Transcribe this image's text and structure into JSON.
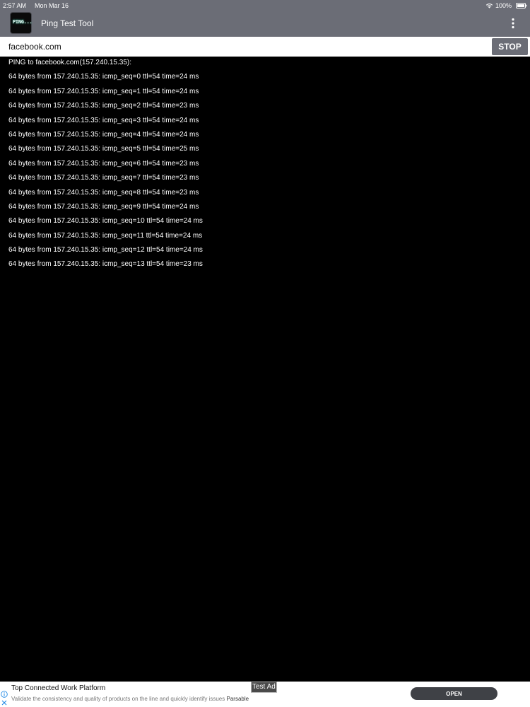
{
  "status_bar": {
    "time": "2:57 AM",
    "date": "Mon Mar 16",
    "battery": "100%",
    "icons": [
      "wifi-icon",
      "battery-icon"
    ]
  },
  "nav": {
    "app_icon_text": "PING...",
    "title": "Ping Test Tool",
    "menu_icon": "more-vertical-icon"
  },
  "address_bar": {
    "host_value": "facebook.com",
    "stop_label": "STOP"
  },
  "output": {
    "header": "PING to facebook.com(157.240.15.35):",
    "lines": [
      "64 bytes from 157.240.15.35: icmp_seq=0 ttl=54 time=24 ms",
      "64 bytes from 157.240.15.35: icmp_seq=1 ttl=54 time=24 ms",
      "64 bytes from 157.240.15.35: icmp_seq=2 ttl=54 time=23 ms",
      "64 bytes from 157.240.15.35: icmp_seq=3 ttl=54 time=24 ms",
      "64 bytes from 157.240.15.35: icmp_seq=4 ttl=54 time=24 ms",
      "64 bytes from 157.240.15.35: icmp_seq=5 ttl=54 time=25 ms",
      "64 bytes from 157.240.15.35: icmp_seq=6 ttl=54 time=23 ms",
      "64 bytes from 157.240.15.35: icmp_seq=7 ttl=54 time=23 ms",
      "64 bytes from 157.240.15.35: icmp_seq=8 ttl=54 time=23 ms",
      "64 bytes from 157.240.15.35: icmp_seq=9 ttl=54 time=24 ms",
      "64 bytes from 157.240.15.35: icmp_seq=10 ttl=54 time=24 ms",
      "64 bytes from 157.240.15.35: icmp_seq=11 ttl=54 time=24 ms",
      "64 bytes from 157.240.15.35: icmp_seq=12 ttl=54 time=24 ms",
      "64 bytes from 157.240.15.35: icmp_seq=13 ttl=54 time=23 ms"
    ]
  },
  "ad": {
    "badge": "Test Ad",
    "title": "Top Connected Work Platform",
    "description": "Validate the consistency and quality of products on the line and quickly identify issues",
    "advertiser": "Parsable",
    "cta_label": "OPEN",
    "icons": [
      "info-icon",
      "close-icon"
    ]
  },
  "colors": {
    "bar_gray": "#6b6d76",
    "background": "#000000",
    "text": "#ffffff",
    "ad_button": "#3f4146",
    "info_blue": "#1e88e5"
  }
}
